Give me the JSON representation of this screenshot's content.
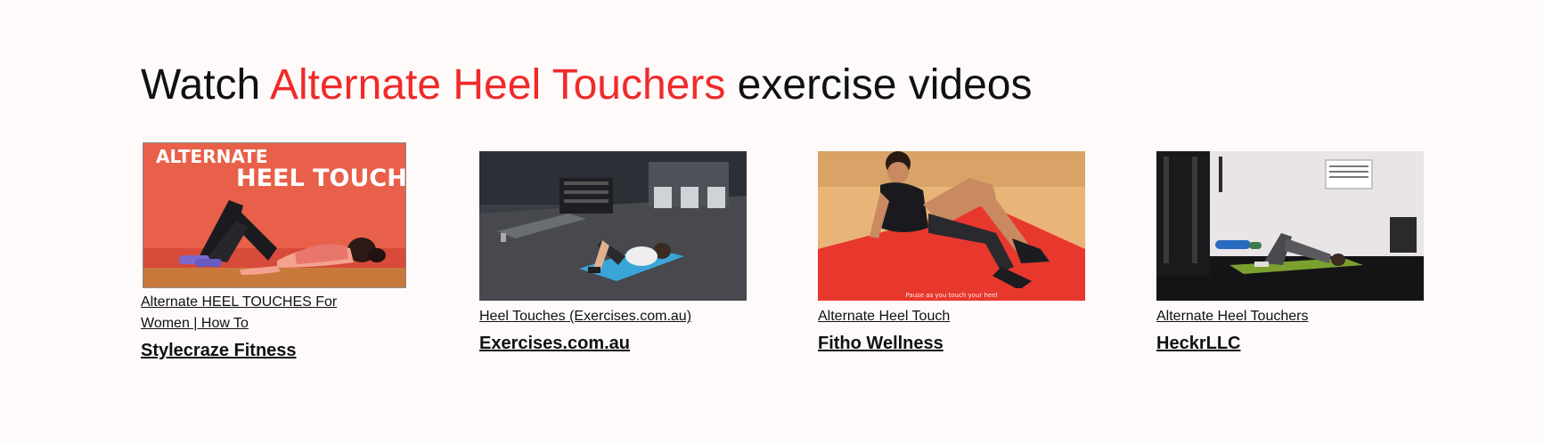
{
  "heading": {
    "prefix": "Watch ",
    "exercise": "Alternate Heel Touchers",
    "suffix": " exercise videos",
    "accent_color": "#f02a2a"
  },
  "videos": [
    {
      "thumbnail_text_line1": "ALTERNATE",
      "thumbnail_text_line2": "HEEL TOUCHES",
      "title": "Alternate HEEL TOUCHES For Women | How To",
      "channel": "Stylecraze Fitness"
    },
    {
      "title": "Heel Touches (Exercises.com.au)",
      "channel": "Exercises.com.au"
    },
    {
      "thumbnail_caption": "Pause as you touch your heel",
      "title": "Alternate Heel Touch",
      "channel": "Fitho Wellness"
    },
    {
      "title": "Alternate Heel Touchers",
      "channel": "HeckrLLC"
    }
  ]
}
